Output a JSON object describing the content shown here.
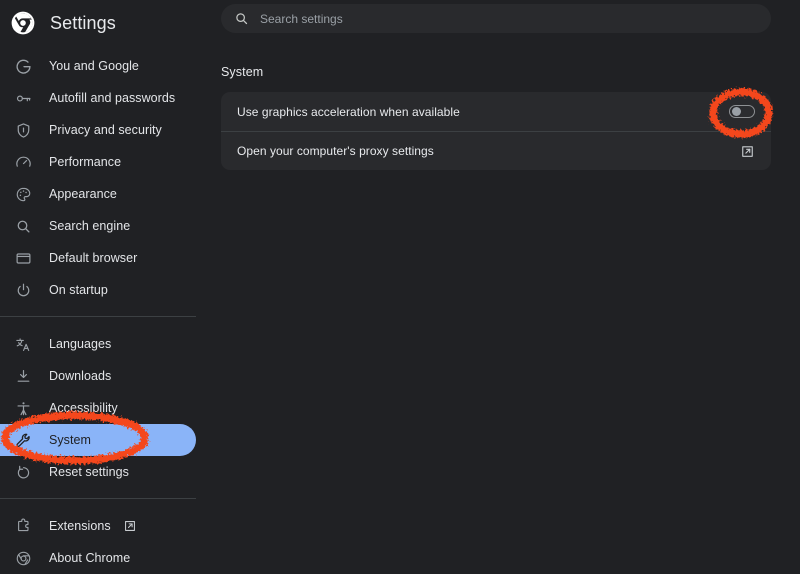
{
  "window": {
    "background_color": "#202124",
    "brand_title": "Settings",
    "logo_icon": "chrome-logo-icon"
  },
  "sidebar": {
    "groups": [
      {
        "items": [
          {
            "label": "You and Google",
            "icon": "google-g-icon",
            "selected": false
          },
          {
            "label": "Autofill and passwords",
            "icon": "key-icon",
            "selected": false
          },
          {
            "label": "Privacy and security",
            "icon": "shield-icon",
            "selected": false
          },
          {
            "label": "Performance",
            "icon": "speedometer-icon",
            "selected": false
          },
          {
            "label": "Appearance",
            "icon": "palette-icon",
            "selected": false
          },
          {
            "label": "Search engine",
            "icon": "magnifier-icon",
            "selected": false
          },
          {
            "label": "Default browser",
            "icon": "browser-window-icon",
            "selected": false
          },
          {
            "label": "On startup",
            "icon": "power-icon",
            "selected": false
          }
        ]
      },
      {
        "items": [
          {
            "label": "Languages",
            "icon": "translate-icon",
            "selected": false
          },
          {
            "label": "Downloads",
            "icon": "download-icon",
            "selected": false
          },
          {
            "label": "Accessibility",
            "icon": "accessibility-person-icon",
            "selected": false
          },
          {
            "label": "System",
            "icon": "wrench-icon",
            "selected": true
          },
          {
            "label": "Reset settings",
            "icon": "restore-icon",
            "selected": false
          }
        ]
      },
      {
        "items": [
          {
            "label": "Extensions",
            "icon": "extension-puzzle-icon",
            "selected": false,
            "external": true
          },
          {
            "label": "About Chrome",
            "icon": "chrome-logo-icon",
            "selected": false
          }
        ]
      }
    ],
    "selected_highlight_color": "#8ab4f8"
  },
  "search": {
    "placeholder": "Search settings",
    "value": "",
    "icon": "search-icon"
  },
  "main": {
    "section_title": "System",
    "rows": [
      {
        "label": "Use graphics acceleration when available",
        "control": "toggle",
        "toggle_state": "off"
      },
      {
        "label": "Open your computer's proxy settings",
        "control": "external-link",
        "icon": "open-in-new-icon"
      }
    ]
  },
  "annotations": {
    "color": "#f4461e",
    "marks": [
      {
        "name": "system-nav-item-circle",
        "shape": "ellipse"
      },
      {
        "name": "graphics-acceleration-toggle-circle",
        "shape": "ellipse"
      }
    ]
  }
}
